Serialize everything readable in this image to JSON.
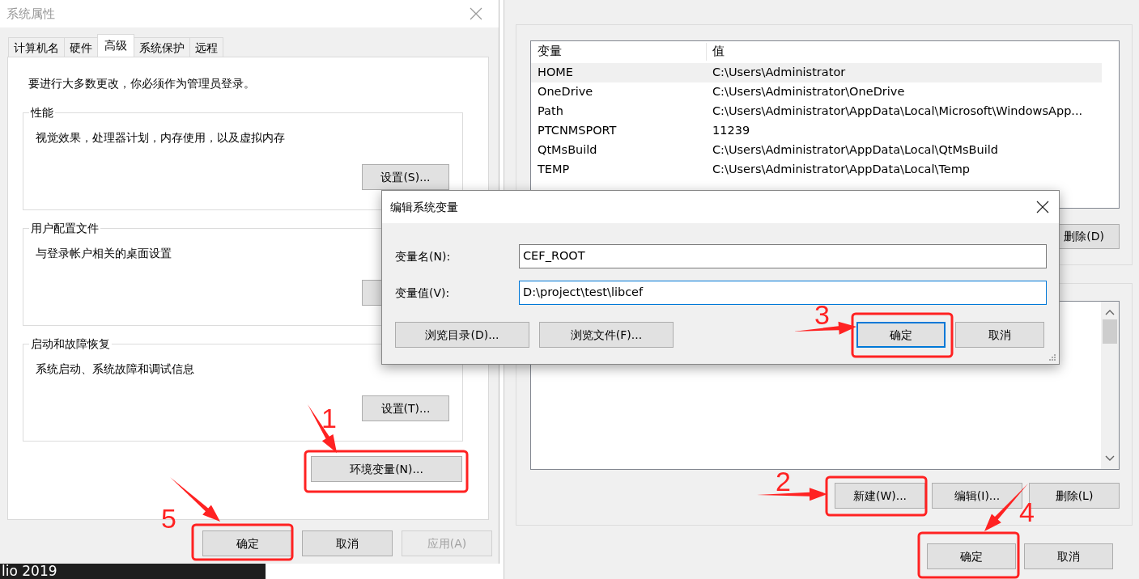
{
  "system_properties": {
    "title": "系统属性",
    "tabs": [
      {
        "label": "计算机名",
        "selected": false
      },
      {
        "label": "硬件",
        "selected": false
      },
      {
        "label": "高级",
        "selected": true
      },
      {
        "label": "系统保护",
        "selected": false
      },
      {
        "label": "远程",
        "selected": false
      }
    ],
    "notice": "要进行大多数更改，你必须作为管理员登录。",
    "groups": [
      {
        "title": "性能",
        "description": "视觉效果，处理器计划，内存使用，以及虚拟内存",
        "button": "设置(S)..."
      },
      {
        "title": "用户配置文件",
        "description": "与登录帐户相关的桌面设置"
      },
      {
        "title": "启动和故障恢复",
        "description": "系统启动、系统故障和调试信息",
        "button": "设置(T)..."
      }
    ],
    "env_button": "环境变量(N)...",
    "buttons": [
      {
        "label": "确定",
        "disabled": false
      },
      {
        "label": "取消",
        "disabled": false
      },
      {
        "label": "应用(A)",
        "disabled": true
      }
    ]
  },
  "environment_variables": {
    "user_table": {
      "columns": [
        "变量",
        "值"
      ],
      "rows": [
        {
          "name": "HOME",
          "value": "C:\\Users\\Administrator",
          "selected": true
        },
        {
          "name": "OneDrive",
          "value": "C:\\Users\\Administrator\\OneDrive",
          "selected": false
        },
        {
          "name": "Path",
          "value": "C:\\Users\\Administrator\\AppData\\Local\\Microsoft\\WindowsApp...",
          "selected": false
        },
        {
          "name": "PTCNMSPORT",
          "value": "11239",
          "selected": false
        },
        {
          "name": "QtMsBuild",
          "value": "C:\\Users\\Administrator\\AppData\\Local\\QtMsBuild",
          "selected": false
        },
        {
          "name": "TEMP",
          "value": "C:\\Users\\Administrator\\AppData\\Local\\Temp",
          "selected": false
        }
      ]
    },
    "user_delete_button": "删除(D)",
    "system_buttons": [
      "新建(W)...",
      "编辑(I)...",
      "删除(L)"
    ],
    "buttons": [
      "确定",
      "取消"
    ]
  },
  "edit_dialog": {
    "title": "编辑系统变量",
    "fields": [
      {
        "label": "变量名(N):",
        "value": "CEF_ROOT",
        "focused": false
      },
      {
        "label": "变量值(V):",
        "value": "D:\\project\\test\\libcef",
        "focused": true
      }
    ],
    "buttons": [
      {
        "label": "浏览目录(D)...",
        "default": false
      },
      {
        "label": "浏览文件(F)...",
        "default": false
      },
      {
        "label": "确定",
        "default": true
      },
      {
        "label": "取消",
        "default": false
      }
    ]
  },
  "annotations": [
    {
      "label": "1"
    },
    {
      "label": "2"
    },
    {
      "label": "3"
    },
    {
      "label": "4"
    },
    {
      "label": "5"
    }
  ],
  "taskbar": {
    "text": "lio 2019"
  }
}
